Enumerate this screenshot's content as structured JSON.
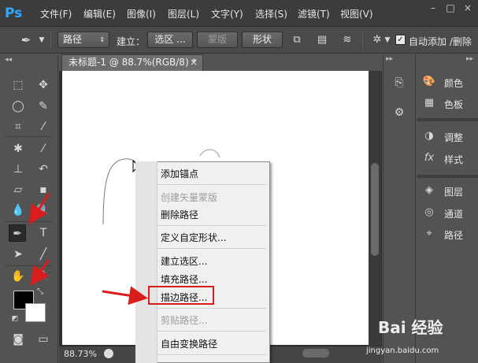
{
  "app": {
    "logo": "Ps"
  },
  "menubar": {
    "items": [
      "文件(F)",
      "编辑(E)",
      "图像(I)",
      "图层(L)",
      "文字(Y)",
      "选择(S)",
      "滤镜(T)",
      "视图(V)"
    ],
    "window_controls": [
      "–",
      "□",
      "×"
    ]
  },
  "options_bar": {
    "mode_select": "路径",
    "build_label": "建立：",
    "selection_button": "选区 ...",
    "mask_button": "蒙版",
    "shape_button": "形状",
    "auto_add_delete_label": "自动添加 /删除",
    "auto_add_delete_checked": true
  },
  "document": {
    "tab_title": "未标题-1 @ 88.7%(RGB/8) *",
    "close_glyph": "×",
    "zoom": "88.73%"
  },
  "context_menu": {
    "items": [
      {
        "label": "添加锚点",
        "enabled": true
      },
      {
        "label": "创建矢量蒙版",
        "enabled": false
      },
      {
        "label": "删除路径",
        "enabled": true
      },
      {
        "label": "定义自定形状...",
        "enabled": true
      },
      {
        "label": "建立选区...",
        "enabled": true
      },
      {
        "label": "填充路径...",
        "enabled": true
      },
      {
        "label": "描边路径...",
        "enabled": true,
        "highlighted": true
      },
      {
        "label": "剪贴路径...",
        "enabled": false
      },
      {
        "label": "自由变换路径",
        "enabled": true
      }
    ]
  },
  "right_panels": {
    "items": [
      {
        "label": "颜色",
        "icon": "palette-icon"
      },
      {
        "label": "色板",
        "icon": "grid-icon"
      },
      {
        "label": "调整",
        "icon": "adjust-icon"
      },
      {
        "label": "样式",
        "icon": "fx-icon"
      },
      {
        "label": "图层",
        "icon": "layers-icon"
      },
      {
        "label": "通道",
        "icon": "channels-icon"
      },
      {
        "label": "路径",
        "icon": "paths-icon"
      }
    ]
  },
  "watermark": {
    "text": "Bai 经验",
    "sub": "jingyan.baidu.com"
  },
  "colors": {
    "accent_red": "#d91c1c",
    "ps_blue": "#31a8ff"
  }
}
